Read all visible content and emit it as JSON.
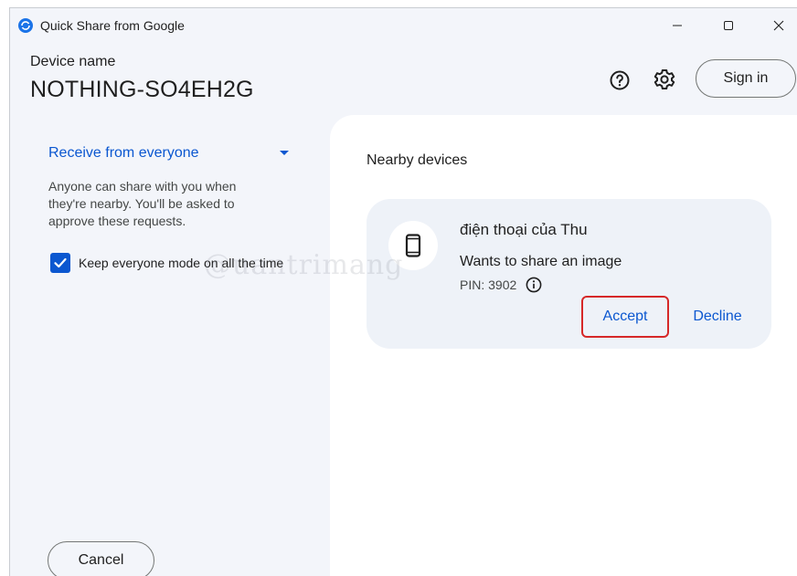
{
  "window": {
    "title": "Quick Share from Google"
  },
  "header": {
    "device_label": "Device name",
    "device_name": "NOTHING-SO4EH2G",
    "sign_in_label": "Sign in"
  },
  "left_panel": {
    "receive_mode": "Receive from everyone",
    "description": "Anyone can share with you when they're nearby. You'll be asked to approve these requests.",
    "keep_everyone_label": "Keep everyone mode on all the time",
    "keep_everyone_checked": true,
    "cancel_label": "Cancel"
  },
  "right_panel": {
    "title": "Nearby devices",
    "request": {
      "sender": "điện thoại của Thu",
      "message": "Wants to share an image",
      "pin": "PIN: 3902",
      "accept_label": "Accept",
      "decline_label": "Decline"
    }
  },
  "watermark": "@uantrimang",
  "colors": {
    "accent": "#0b57d0",
    "highlight": "#d62828",
    "window_bg": "#f3f5fa",
    "card_bg": "#eef2f8"
  },
  "icons": {
    "app": "quick-share-icon",
    "help": "help-circle-icon",
    "settings": "gear-icon",
    "device": "phone-icon",
    "pin_info": "info-icon",
    "check": "check-icon",
    "dropdown": "triangle-down-icon"
  }
}
